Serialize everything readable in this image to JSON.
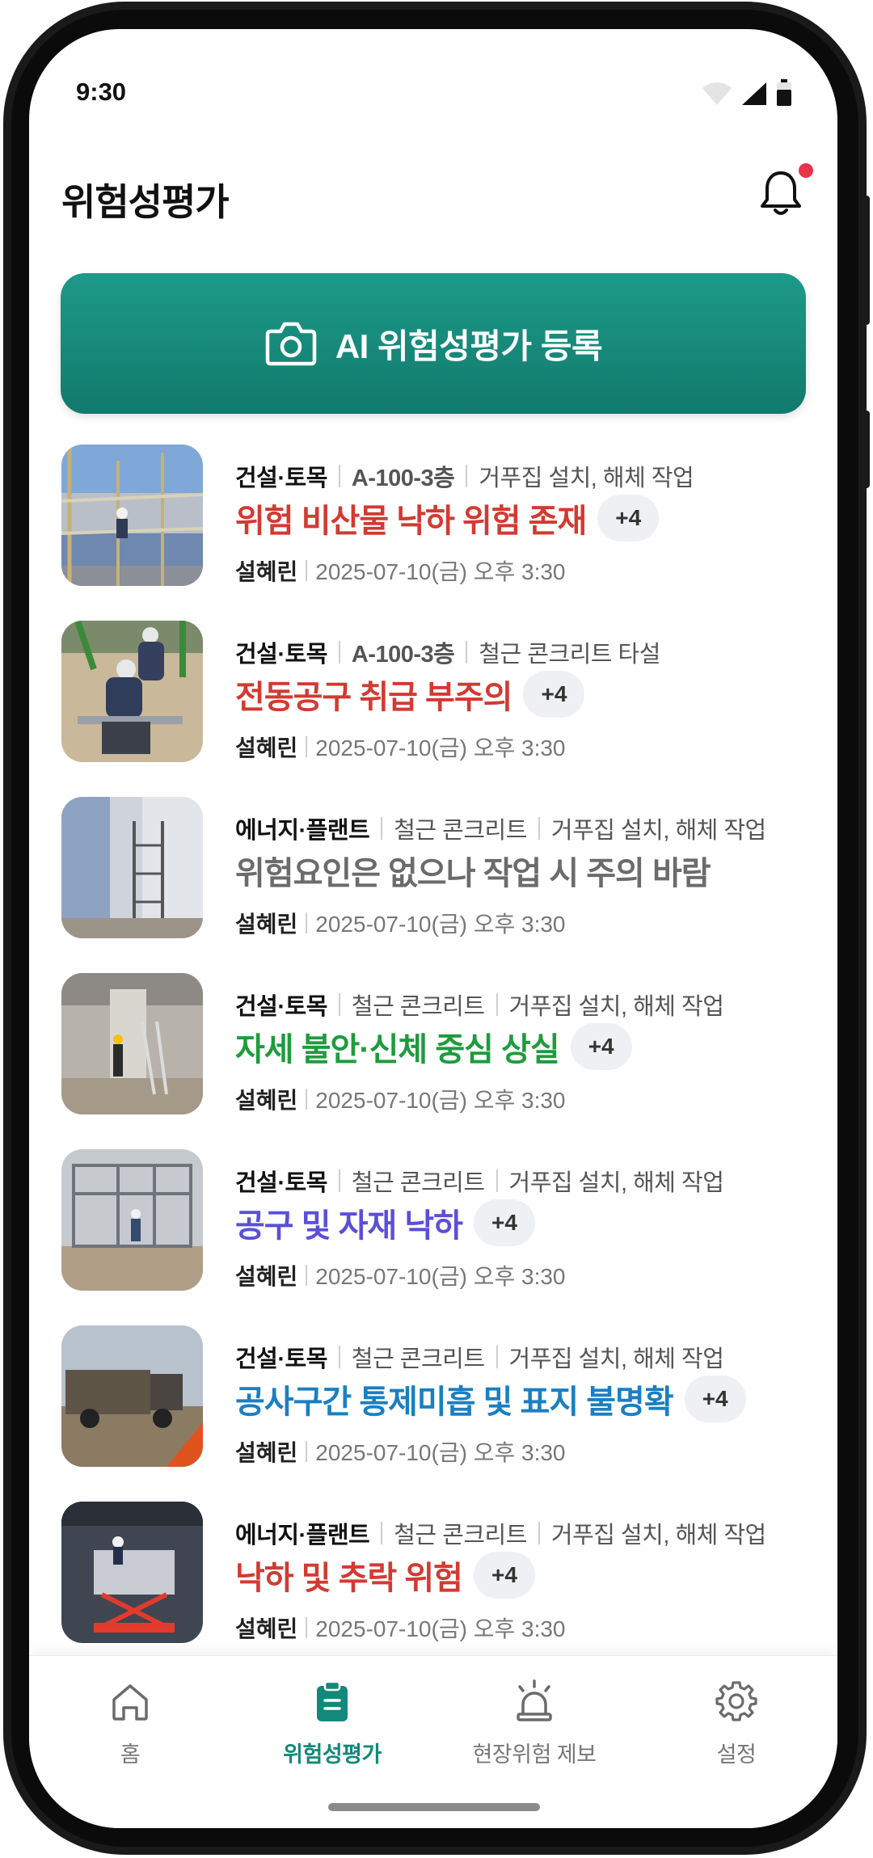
{
  "status_bar": {
    "time": "9:30"
  },
  "header": {
    "title": "위험성평가"
  },
  "ai_button": {
    "label": "AI 위험성평가 등록"
  },
  "items": [
    {
      "category": "건설·토목",
      "location": "A-100-3층",
      "work": "거푸집 설치, 해체 작업",
      "hazard": "위험 비산물 낙하 위험 존재",
      "hazard_color": "#d23a32",
      "more": "+4",
      "author": "설혜린",
      "datetime": "2025-07-10(금) 오후 3:30",
      "thumb_icon": "scaffold-photo"
    },
    {
      "category": "건설·토목",
      "location": "A-100-3층",
      "work": "철근 콘크리트 타설",
      "hazard": "전동공구 취급 부주의",
      "hazard_color": "#d23a32",
      "more": "+4",
      "author": "설혜린",
      "datetime": "2025-07-10(금) 오후 3:30",
      "thumb_icon": "workers-photo"
    },
    {
      "category": "에너지·플랜트",
      "location": "철근 콘크리트",
      "work": "거푸집 설치, 해체 작업",
      "hazard": "위험요인은 없으나 작업 시 주의 바람",
      "hazard_color": "#6b6b6b",
      "more": "",
      "author": "설혜린",
      "datetime": "2025-07-10(금) 오후 3:30",
      "thumb_icon": "ladder-photo"
    },
    {
      "category": "건설·토목",
      "location": "철근 콘크리트",
      "work": "거푸집 설치, 해체 작업",
      "hazard": "자세 불안·신체 중심 상실",
      "hazard_color": "#1f9b3e",
      "more": "+4",
      "author": "설혜린",
      "datetime": "2025-07-10(금) 오후 3:30",
      "thumb_icon": "column-photo"
    },
    {
      "category": "건설·토목",
      "location": "철근 콘크리트",
      "work": "거푸집 설치, 해체 작업",
      "hazard": "공구 및 자재 낙하",
      "hazard_color": "#5a4fd9",
      "more": "+4",
      "author": "설혜린",
      "datetime": "2025-07-10(금) 오후 3:30",
      "thumb_icon": "frame-photo"
    },
    {
      "category": "건설·토목",
      "location": "철근 콘크리트",
      "work": "거푸집 설치, 해체 작업",
      "hazard": "공사구간 통제미흡 및 표지 불명확",
      "hazard_color": "#1a7fc2",
      "more": "+4",
      "author": "설혜린",
      "datetime": "2025-07-10(금) 오후 3:30",
      "thumb_icon": "truck-photo"
    },
    {
      "category": "에너지·플랜트",
      "location": "철근 콘크리트",
      "work": "거푸집 설치, 해체 작업",
      "hazard": "낙하 및 추락 위험",
      "hazard_color": "#d23a32",
      "more": "+4",
      "author": "설혜린",
      "datetime": "2025-07-10(금) 오후 3:30",
      "thumb_icon": "lift-photo"
    }
  ],
  "nav": {
    "home": "홈",
    "risk": "위험성평가",
    "report": "현장위험 제보",
    "settings": "설정",
    "active_color": "#12897a"
  }
}
